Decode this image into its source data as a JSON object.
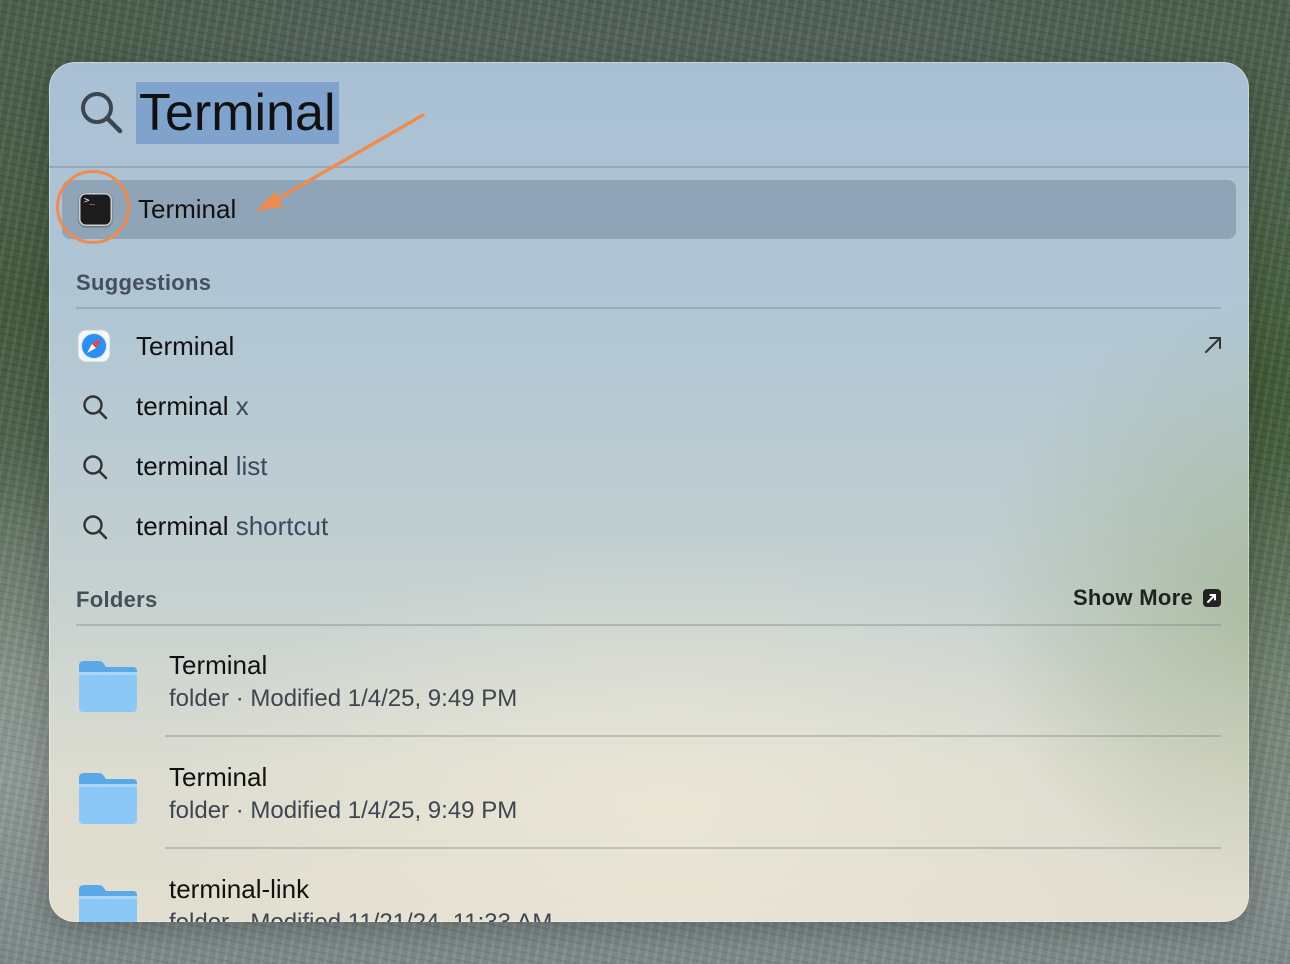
{
  "search": {
    "query": "Terminal"
  },
  "top_hit": {
    "label": "Terminal",
    "icon": "terminal-app-icon",
    "icon_glyph": ">_"
  },
  "annotation": {
    "color": "#ee8c4f"
  },
  "suggestions": {
    "title": "Suggestions",
    "items": [
      {
        "prefix": "Terminal",
        "suffix": "",
        "icon": "safari-compass-icon"
      },
      {
        "prefix": "terminal",
        "suffix": " x",
        "icon": "search-icon"
      },
      {
        "prefix": "terminal",
        "suffix": " list",
        "icon": "search-icon"
      },
      {
        "prefix": "terminal",
        "suffix": " shortcut",
        "icon": "search-icon"
      }
    ]
  },
  "folders": {
    "title": "Folders",
    "show_more": "Show More",
    "items": [
      {
        "name": "Terminal",
        "meta": "folder · Modified 1/4/25, 9:49 PM"
      },
      {
        "name": "Terminal",
        "meta": "folder · Modified 1/4/25, 9:49 PM"
      },
      {
        "name": "terminal-link",
        "meta": "folder · Modified 11/21/24, 11:33 AM"
      }
    ]
  },
  "colors": {
    "selection": "#7fa3cc",
    "top_hit_bg": "#8a9db0"
  }
}
